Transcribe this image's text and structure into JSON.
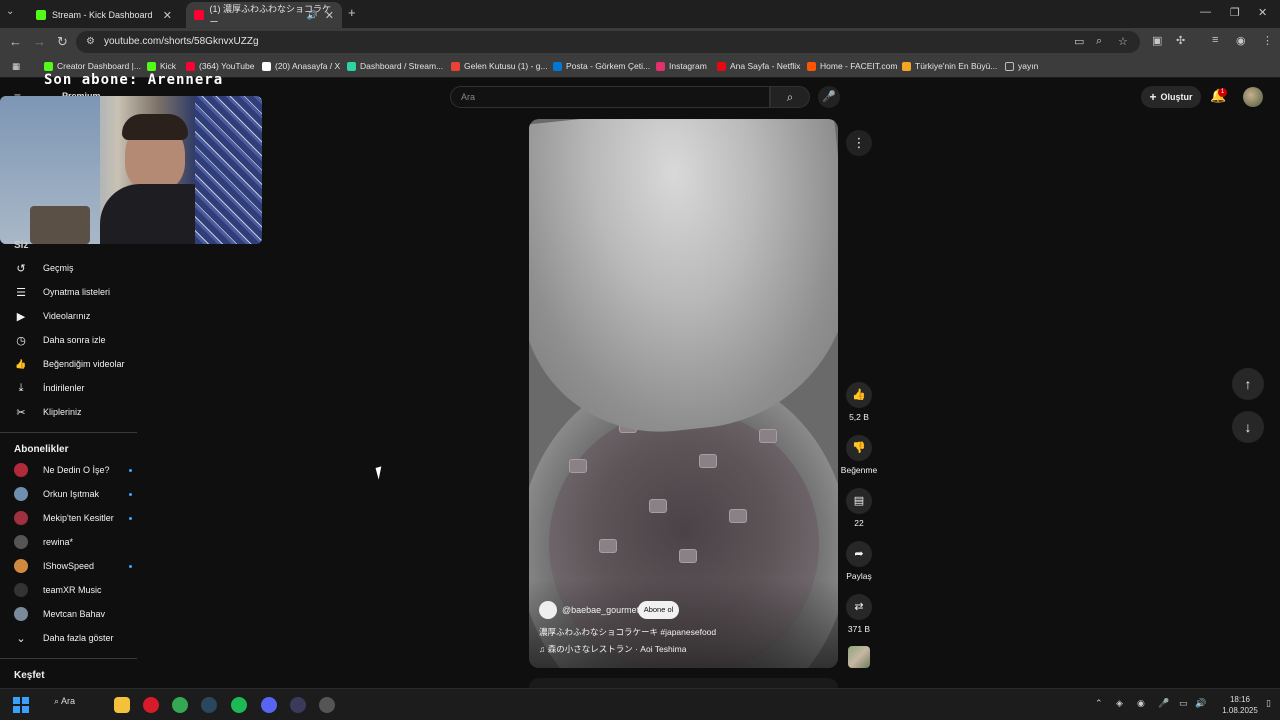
{
  "browser": {
    "tabs": [
      {
        "title": "Stream - Kick Dashboard",
        "favicon_color": "#53fc18"
      },
      {
        "title": "(1) 濃厚ふわふわなショコラケー",
        "favicon_color": "#ff0033"
      }
    ],
    "url": "youtube.com/shorts/58GknvxUZZg",
    "bookmarks": [
      {
        "label": "Creator Dashboard |...",
        "color": "#53fc18"
      },
      {
        "label": "Kick",
        "color": "#53fc18"
      },
      {
        "label": "(364) YouTube",
        "color": "#ff0033"
      },
      {
        "label": "(20) Anasayfa / X",
        "color": "#ffffff"
      },
      {
        "label": "Dashboard / Stream...",
        "color": "#2dd4a3"
      },
      {
        "label": "Gelen Kutusu (1) - g...",
        "color": "#ea4335"
      },
      {
        "label": "Posta - Görkem Çeti...",
        "color": "#0078d4"
      },
      {
        "label": "Instagram",
        "color": "#e1306c"
      },
      {
        "label": "Ana Sayfa - Netflix",
        "color": "#e50914"
      },
      {
        "label": "Home - FACEIT.com",
        "color": "#ff5500"
      },
      {
        "label": "Türkiye'nin En Büyü...",
        "color": "#f5a623"
      },
      {
        "label": "yayın",
        "color": "#bbbbbb"
      }
    ]
  },
  "overlay": {
    "stream_text": "Son abone: Arennera",
    "premium_label": "Premium",
    "siz_label": "Siz"
  },
  "sidebar": {
    "you_items": [
      {
        "label": "Geçmiş",
        "icon": "history-icon",
        "glyph": "↺"
      },
      {
        "label": "Oynatma listeleri",
        "icon": "playlist-icon",
        "glyph": "☰"
      },
      {
        "label": "Videolarınız",
        "icon": "your-videos-icon",
        "glyph": "▶"
      },
      {
        "label": "Daha sonra izle",
        "icon": "watch-later-icon",
        "glyph": "◷"
      },
      {
        "label": "Beğendiğim videolar",
        "icon": "liked-icon",
        "glyph": "👍"
      },
      {
        "label": "İndirilenler",
        "icon": "download-icon",
        "glyph": "⤓"
      },
      {
        "label": "Klipleriniz",
        "icon": "clips-icon",
        "glyph": "✂"
      }
    ],
    "subscriptions_heading": "Abonelikler",
    "subscriptions": [
      {
        "label": "Ne Dedin O İşe?",
        "color": "#b02a3a",
        "dot": true
      },
      {
        "label": "Orkun Işıtmak",
        "color": "#6f8fb0",
        "dot": true
      },
      {
        "label": "Mekip'ten Kesitler",
        "color": "#a03040",
        "dot": true
      },
      {
        "label": "rewina*",
        "color": "#555555",
        "dot": false
      },
      {
        "label": "IShowSpeed",
        "color": "#d08a40",
        "dot": true
      },
      {
        "label": "teamXR Music",
        "color": "#333333",
        "dot": false
      },
      {
        "label": "Mevtcan Bahav",
        "color": "#7a8a9a",
        "dot": false
      }
    ],
    "show_more_label": "Daha fazla göster",
    "explore_heading": "Keşfet"
  },
  "header": {
    "search_placeholder": "Ara",
    "create_label": "Oluştur",
    "notification_count": "1"
  },
  "short": {
    "channel": "@baebae_gourmet",
    "subscribe_label": "Abone ol",
    "title": "濃厚ふわふわなショコラケーキ #japanesefood",
    "music": "♫ 森の小さなレストラン · Aoi Teshima",
    "actions": [
      {
        "name": "like",
        "icon": "thumb-up-icon",
        "glyph": "👍",
        "label": "5,2 B"
      },
      {
        "name": "dislike",
        "icon": "thumb-down-icon",
        "glyph": "👎",
        "label": "Beğenme"
      },
      {
        "name": "comments",
        "icon": "comment-icon",
        "glyph": "▤",
        "label": "22"
      },
      {
        "name": "share",
        "icon": "share-icon",
        "glyph": "➦",
        "label": "Paylaş"
      },
      {
        "name": "remix",
        "icon": "remix-icon",
        "glyph": "⇄",
        "label": "371 B"
      }
    ]
  },
  "taskbar": {
    "search_label": "Ara",
    "time": "18:16",
    "date": "1.08.2025",
    "apps": [
      {
        "name": "file-explorer",
        "color": "#f3c13a"
      },
      {
        "name": "opera",
        "color": "#d61c2b"
      },
      {
        "name": "chrome",
        "color": "#34a853"
      },
      {
        "name": "steam",
        "color": "#2a475e"
      },
      {
        "name": "spotify",
        "color": "#1db954"
      },
      {
        "name": "discord",
        "color": "#5865f2"
      },
      {
        "name": "obs",
        "color": "#3a3a5a"
      },
      {
        "name": "app",
        "color": "#555555"
      }
    ]
  }
}
